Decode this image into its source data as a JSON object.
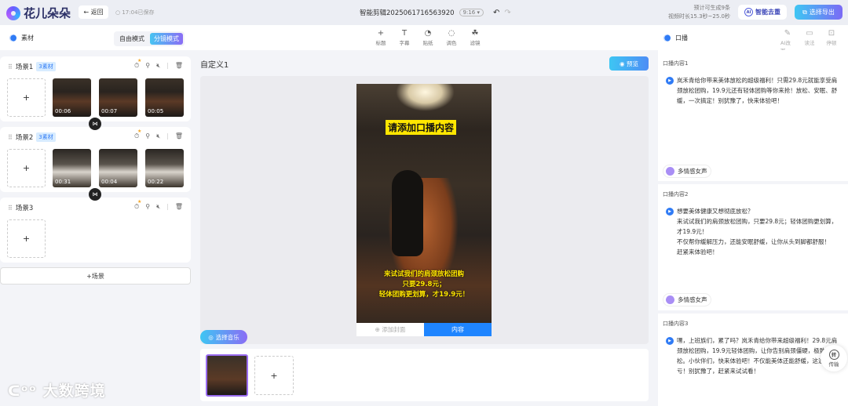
{
  "header": {
    "app_name": "花儿朵朵",
    "back_label": "← 返回",
    "saved_status": "17:04已保存",
    "doc_title": "智能剪辑2025061716563920",
    "ratio": "9:16 ▾",
    "undo_icon": "undo-icon",
    "redo_icon": "redo-icon",
    "estimate_line1": "预计可生成9条",
    "estimate_line2": "视频时长15.3秒~25.0秒",
    "ai_button": "智能去重",
    "ai_badge": "AI",
    "export_button": "选择导出"
  },
  "toolbar": {
    "material_label": "素材",
    "modes": [
      "自由模式",
      "分镜模式"
    ],
    "tools": [
      {
        "icon": "+",
        "label": "标题"
      },
      {
        "icon": "T",
        "label": "字幕"
      },
      {
        "icon": "◔",
        "label": "贴纸"
      },
      {
        "icon": "◌",
        "label": "调色"
      },
      {
        "icon": "☘",
        "label": "滤镜"
      }
    ],
    "voice_label": "口播",
    "right_tools": [
      {
        "icon": "✎",
        "label": "AI改写"
      },
      {
        "icon": "▭",
        "label": "读法"
      },
      {
        "icon": "⊡",
        "label": "停顿"
      }
    ]
  },
  "scenes": [
    {
      "name": "场景1",
      "badge": "3素材",
      "clips": [
        "00:06",
        "00:07",
        "00:05"
      ]
    },
    {
      "name": "场景2",
      "badge": "3素材",
      "clips": [
        "00:31",
        "00:04",
        "00:22"
      ]
    },
    {
      "name": "场景3",
      "badge": "",
      "clips": []
    }
  ],
  "add_scene_label": "+场景",
  "add_slot": "+",
  "transition_icon": "⋈",
  "watermark": "大数跨境",
  "center": {
    "title": "自定义1",
    "preview_button": "预览",
    "caption_top": "请添加口播内容",
    "caption_bottom": [
      "来试试我们的肩颈放松团购",
      "只要29.8元；",
      "轻体团购更划算，才19.9元！"
    ],
    "add_cover": "⊕ 添加封面",
    "content_tab": "内容",
    "music_button": "选择音乐",
    "strip_add": "+"
  },
  "voice": {
    "items": [
      {
        "label": "口播内容1",
        "text": "岚禾青给你带来美体放松的超级福利！只需29.8元就能享受肩颈放松团购，19.9元还有轻体团购等你来抢！放松、安眠、舒缓，一次搞定！别犹豫了，快来体验吧！",
        "voice": "多情感女声"
      },
      {
        "label": "口播内容2",
        "text": "想要美体健康又想彻底放松？\n来试试我们的肩颈放松团购，只要29.8元；轻体团购更划算，才19.9元！\n不仅帮你缓解压力，还能安眠舒缓，让你从头到脚都舒服！\n赶紧来体验吧！",
        "voice": "多情感女声"
      },
      {
        "label": "口播内容3",
        "text": "嘿，上班族们，累了吗？岚禾青给你带来超级福利！29.8元肩颈放松团购，19.9元轻体团购，让你告别肩颈僵硬，极致放松。小伙伴们，快来体验吧！不仅能美体还能舒缓，这波真的不亏！别犹豫了，赶紧来试试看！",
        "voice": ""
      }
    ],
    "transfer_label": "传输",
    "transfer_icon": "转"
  }
}
